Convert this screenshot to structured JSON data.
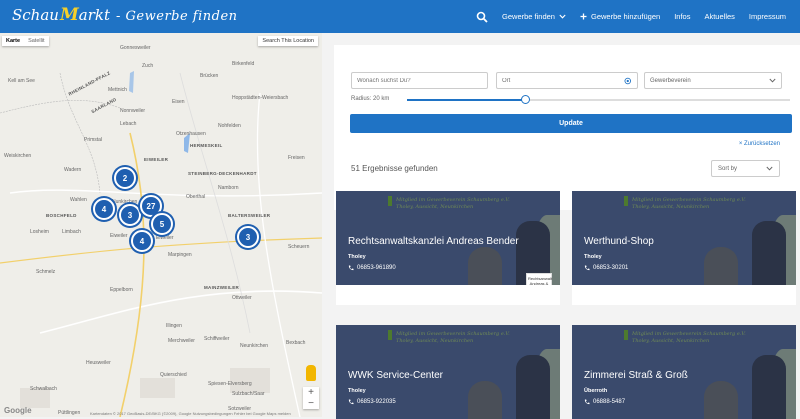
{
  "header": {
    "logo_part1": "Schau",
    "logo_part2": "M",
    "logo_part3": "arkt",
    "logo_part4": "- Gewerbe finden",
    "nav": {
      "gewerbe_finden": "Gewerbe finden",
      "gewerbe_hinzufuegen": "Gewerbe hinzufügen",
      "infos": "Infos",
      "aktuelles": "Aktuelles",
      "impressum": "Impressum"
    }
  },
  "map": {
    "toggle_map": "Karte",
    "toggle_satellite": "Satellit",
    "search_this_location": "Search This Location",
    "clusters": [
      "2",
      "4",
      "3",
      "27",
      "5",
      "4",
      "3"
    ],
    "labels": [
      "Gonnesweiler",
      "Zuch",
      "Mettnich",
      "Brücken",
      "Birkenfeld",
      "Eisen",
      "Hoppstädten-Weiersbach",
      "Wadern",
      "Nohfelden",
      "Nunkirchen",
      "Weiskirchen",
      "Oberthal",
      "Namborn",
      "Freisen",
      "Schmelz",
      "Marpingen",
      "Eppelborn",
      "Ottweiler",
      "Illingen",
      "Merchweiler",
      "Neunkirchen",
      "Bexbach",
      "Heusweiler",
      "Quierschied",
      "Schwalbach",
      "Püttlingen",
      "Eiweiler",
      "Lebach",
      "Nonnweiler",
      "Otzenhausen",
      "Kell am See",
      "Wahlen",
      "Losheim",
      "Primstal",
      "Eiweiler",
      "Limbach",
      "Scheuern",
      "Schiffweiler",
      "Spiesen-Elversberg",
      "Sulzbach/Saar",
      "Sotzweiler"
    ],
    "bold_labels": [
      "RHEINLAND-PFALZ",
      "SAARLAND",
      "EIWEILER",
      "STEINBERG-DECKENHARDT",
      "BOSCHFELD",
      "BALTERSWEILER",
      "MAINZWEILER",
      "HERMESKEIL"
    ],
    "attribution": "Kartendaten © 2017 GeoBasis-DE/BKG (©2009), Google   Nutzungsbedingungen   Fehler bei Google Maps melden",
    "google": "Google"
  },
  "search": {
    "what_placeholder": "Wonach suchst Du?",
    "where_placeholder": "Ort",
    "association_selected": "Gewerbeverein",
    "radius_label": "Radius: 20 km",
    "radius_fraction": 0.31,
    "update_label": "Update",
    "reset_label": "× Zurücksetzen",
    "results_text": "51 Ergebnisse gefunden",
    "sort_selected": "Sort by"
  },
  "listings": [
    {
      "title": "Rechtsanwaltskanzlei Andreas Bender",
      "city": "Tholey",
      "phone": "06853-961890",
      "badge": "Rechtsanwalt Andreas & Bender",
      "member_line1": "Mitglied im Gewerbeverein Schaumberg e.V.",
      "member_line2": "Tholey, Aussicht, Neunkirchen"
    },
    {
      "title": "Werthund-Shop",
      "city": "Tholey",
      "phone": "06853-30201",
      "member_line1": "Mitglied im Gewerbeverein Schaumberg e.V.",
      "member_line2": "Tholey, Aussicht, Neunkirchen"
    },
    {
      "title": "WWK Service-Center",
      "city": "Tholey",
      "phone": "06853-922035",
      "member_line1": "Mitglied im Gewerbeverein Schaumberg e.V.",
      "member_line2": "Tholey, Aussicht, Neunkirchen"
    },
    {
      "title": "Zimmerei Straß & Groß",
      "city": "Überroth",
      "phone": "06888-5487",
      "member_line1": "Mitglied im Gewerbeverein Schaumberg e.V.",
      "member_line2": "Tholey, Aussicht, Neunkirchen"
    }
  ],
  "colors": {
    "brand_blue": "#1f73c5",
    "logo_accent": "#f5d02a",
    "card_hero": "#3a4a6c",
    "cluster_blue": "#1f5fb0"
  }
}
